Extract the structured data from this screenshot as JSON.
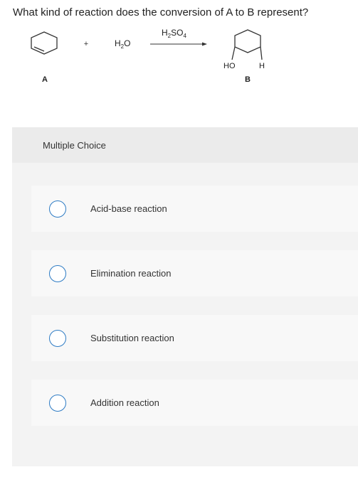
{
  "question": {
    "text": "What kind of reaction does the conversion of A to B represent?"
  },
  "scheme": {
    "plus": "+",
    "water": {
      "main": "H",
      "sub": "2",
      "tail": "O"
    },
    "reagent": {
      "h": "H",
      "sub2": "2",
      "so": "SO",
      "sub4": "4"
    },
    "label_a": "A",
    "label_b": "B",
    "ho": "HO",
    "h": "H"
  },
  "multiple_choice": {
    "title": "Multiple Choice",
    "options": [
      {
        "label": "Acid-base reaction",
        "selected": false
      },
      {
        "label": "Elimination reaction",
        "selected": false
      },
      {
        "label": "Substitution reaction",
        "selected": false
      },
      {
        "label": "Addition reaction",
        "selected": false
      }
    ]
  },
  "colors": {
    "radio_border": "#2d7bc4",
    "panel_bg": "#f3f3f3",
    "header_bg": "#ebebeb",
    "option_bg": "#f8f8f8"
  }
}
